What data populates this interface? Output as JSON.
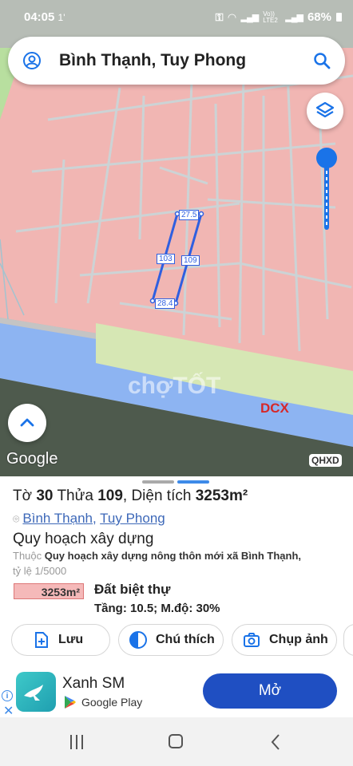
{
  "status_bar": {
    "time": "04:05",
    "extra": "1'",
    "network": "Vo)) LTE2",
    "battery": "68%"
  },
  "search": {
    "title": "Bình Thạnh, Tuy Phong"
  },
  "map": {
    "edge_labels": {
      "top": "27.5",
      "left": "103",
      "right": "109",
      "bottom": "28.4"
    },
    "zone_label": "DCX",
    "watermark": "chợTỐT",
    "google_logo": "Google",
    "corner_label": "QHXD"
  },
  "panel": {
    "to_label": "Tờ",
    "to_value": "30",
    "thua_label": "Thửa",
    "thua_value": "109",
    "area_label": "Diện tích",
    "area_value": "3253m²",
    "location_commune": "Bình Thạnh",
    "location_sep": ", ",
    "location_district": "Tuy Phong",
    "section_title": "Quy hoạch xây dựng",
    "belongs_prefix": "Thuộc ",
    "plan_name": "Quy hoạch xây dựng nông thôn mới xã Bình Thạnh,",
    "scale": "tỷ lệ 1/5000",
    "area_badge": "3253m²",
    "land_type": "Đất biệt thự",
    "floors_density": "Tầng: 10.5; M.độ: 30%",
    "buttons": {
      "save": "Lưu",
      "zoning": "Chú thích",
      "capture": "Chụp ảnh"
    }
  },
  "ad": {
    "app_name": "Xanh SM",
    "store": "Google Play",
    "open_button": "Mở"
  },
  "colors": {
    "zone_pink": "#f1b6b3",
    "river_blue": "#8db4f2",
    "accent_blue": "#1a73e8",
    "parcel_blue": "#2f5fe0",
    "open_button": "#1f4fc2"
  }
}
